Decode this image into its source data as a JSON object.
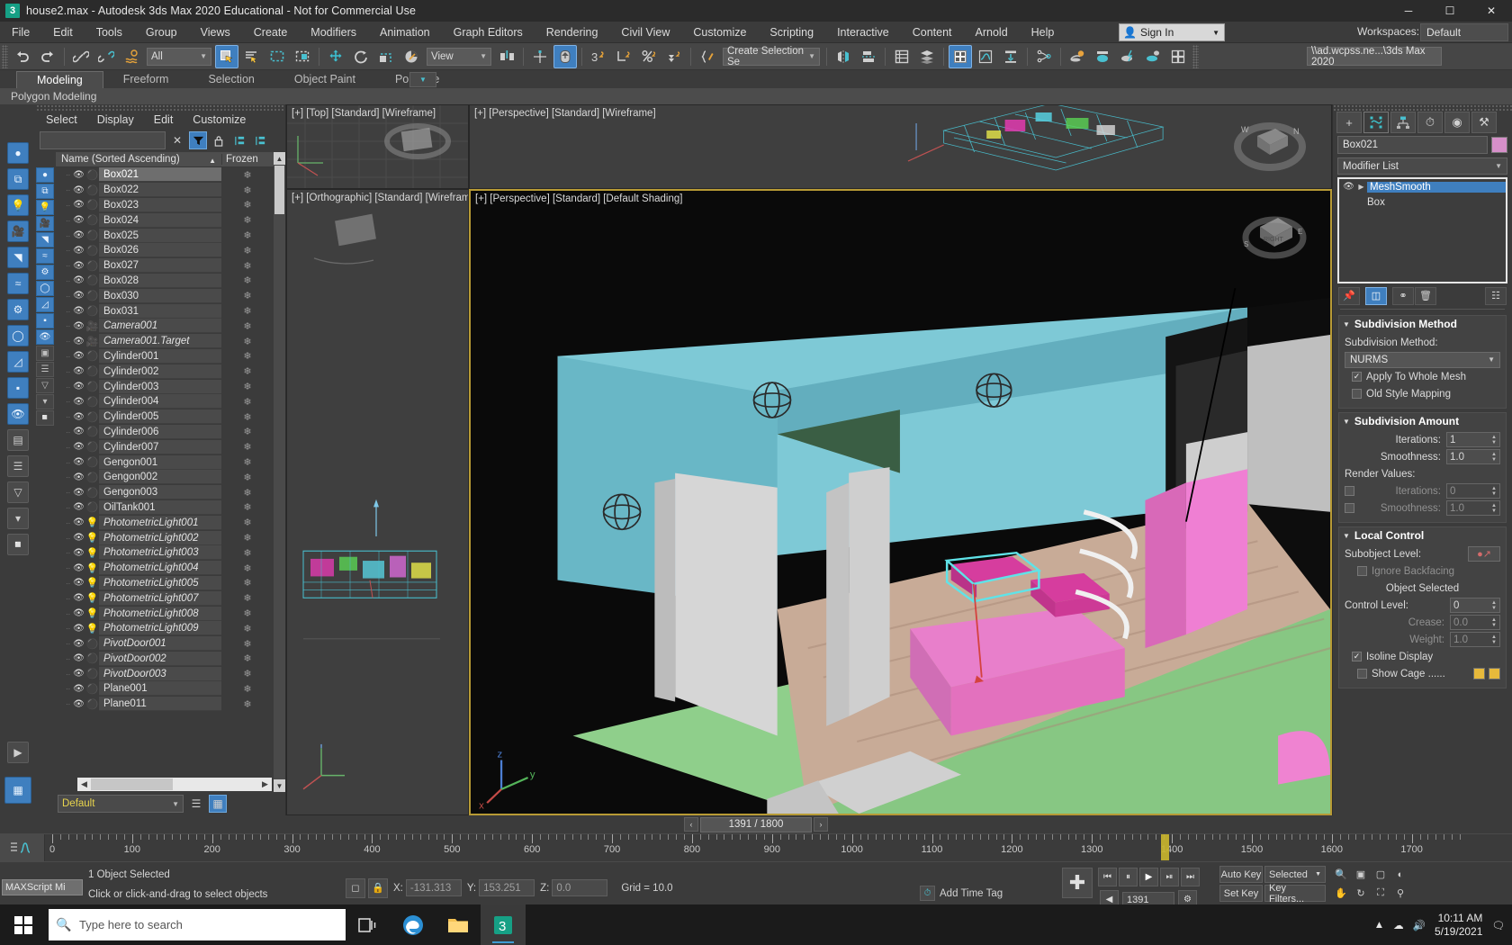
{
  "titlebar": {
    "text": "house2.max - Autodesk 3ds Max 2020 Educational - Not for Commercial Use",
    "app_icon": "3dsmax-icon",
    "minimize": "─",
    "maximize": "☐",
    "close": "✕"
  },
  "menubar": {
    "items": [
      "File",
      "Edit",
      "Tools",
      "Group",
      "Views",
      "Create",
      "Modifiers",
      "Animation",
      "Graph Editors",
      "Rendering",
      "Civil View",
      "Customize",
      "Scripting",
      "Interactive",
      "Content",
      "Arnold",
      "Help"
    ],
    "signin_label": "Sign In",
    "workspaces_label": "Workspaces:",
    "workspaces_value": "Default"
  },
  "toolbar": {
    "selection_filter": "All",
    "reference_coord": "View",
    "named_selection_set": "Create Selection Se",
    "project_path": "\\\\ad.wcpss.ne...\\3ds Max 2020",
    "buttons": [
      {
        "name": "undo",
        "glyph": "↶"
      },
      {
        "name": "redo",
        "glyph": "↷"
      },
      {
        "name": "select-and-link",
        "glyph": "⚭"
      },
      {
        "name": "unlink-selection",
        "glyph": "⚮"
      },
      {
        "name": "bind-to-space-warp",
        "glyph": "≈"
      },
      {
        "name": "select-object",
        "glyph": "◱"
      },
      {
        "name": "select-by-name",
        "glyph": "≣"
      },
      {
        "name": "rectangular-selection-region",
        "glyph": "⬚"
      },
      {
        "name": "window-crossing",
        "glyph": "▣"
      },
      {
        "name": "select-and-move",
        "glyph": "✥"
      },
      {
        "name": "select-and-rotate",
        "glyph": "↻"
      },
      {
        "name": "select-and-scale",
        "glyph": "◰"
      },
      {
        "name": "select-and-place",
        "glyph": "◔"
      },
      {
        "name": "use-center-flyout",
        "glyph": "⌖"
      },
      {
        "name": "select-and-manipulate",
        "glyph": "⬆"
      },
      {
        "name": "snaps-toggle",
        "glyph": "3"
      },
      {
        "name": "angle-snap-toggle",
        "glyph": "∠"
      },
      {
        "name": "percent-snap-toggle",
        "glyph": "%"
      },
      {
        "name": "spinner-snap-toggle",
        "glyph": "⇅"
      },
      {
        "name": "edit-named-selection-sets",
        "glyph": "{ }"
      },
      {
        "name": "mirror",
        "glyph": "◧"
      },
      {
        "name": "align",
        "glyph": "☷"
      },
      {
        "name": "layer-explorer",
        "glyph": "☰"
      },
      {
        "name": "scene-explorer",
        "glyph": "☲"
      },
      {
        "name": "curve-editor",
        "glyph": "∿"
      },
      {
        "name": "schematic-view",
        "glyph": "⤓"
      },
      {
        "name": "material-editor",
        "glyph": "⧉"
      },
      {
        "name": "render-setup",
        "glyph": "⚙"
      },
      {
        "name": "rendered-frame-window",
        "glyph": "▦"
      },
      {
        "name": "render-production",
        "glyph": "⚡"
      },
      {
        "name": "render-iterative",
        "glyph": "◑"
      },
      {
        "name": "open-asset-tracking",
        "glyph": "⊞"
      }
    ]
  },
  "ribbon": {
    "tabs": [
      "Modeling",
      "Freeform",
      "Selection",
      "Object Paint",
      "Populate"
    ],
    "active_tab": "Modeling",
    "panel_label": "Polygon Modeling"
  },
  "scene_explorer": {
    "menu": [
      "Select",
      "Display",
      "Edit",
      "Customize"
    ],
    "search_value": "",
    "clear_icon": "✕",
    "filter_icon": "filter-icon",
    "lock_icon": "lock-icon",
    "expand_icon": "expand-all-icon",
    "collapse_icon": "collapse-all-icon",
    "columns": {
      "name": "Name (Sorted Ascending)",
      "sort_arrow": "▲",
      "frozen": "Frozen"
    },
    "filter_buttons": [
      "geometry-filter",
      "shapes-filter",
      "lights-filter",
      "cameras-filter",
      "helpers-filter",
      "space-warps-filter",
      "groups-filter",
      "xrefs-filter",
      "bones-filter",
      "hidden-filter",
      "frozen-filter",
      "layers-filter",
      "containers-filter",
      "sort-filter",
      "advanced-filter",
      "misc-filter"
    ],
    "layer_selector": "Default",
    "rows": [
      {
        "name": "Box021",
        "type": "geometry",
        "selected": true,
        "italic": false,
        "frozen": "❄"
      },
      {
        "name": "Box022",
        "type": "geometry",
        "selected": false,
        "italic": false,
        "frozen": "❄"
      },
      {
        "name": "Box023",
        "type": "geometry",
        "selected": false,
        "italic": false,
        "frozen": "❄"
      },
      {
        "name": "Box024",
        "type": "geometry",
        "selected": false,
        "italic": false,
        "frozen": "❄"
      },
      {
        "name": "Box025",
        "type": "geometry",
        "selected": false,
        "italic": false,
        "frozen": "❄"
      },
      {
        "name": "Box026",
        "type": "geometry",
        "selected": false,
        "italic": false,
        "frozen": "❄"
      },
      {
        "name": "Box027",
        "type": "geometry",
        "selected": false,
        "italic": false,
        "frozen": "❄"
      },
      {
        "name": "Box028",
        "type": "geometry",
        "selected": false,
        "italic": false,
        "frozen": "❄"
      },
      {
        "name": "Box030",
        "type": "geometry",
        "selected": false,
        "italic": false,
        "frozen": "❄"
      },
      {
        "name": "Box031",
        "type": "geometry",
        "selected": false,
        "italic": false,
        "frozen": "❄"
      },
      {
        "name": "Camera001",
        "type": "camera",
        "selected": false,
        "italic": true,
        "frozen": "❄"
      },
      {
        "name": "Camera001.Target",
        "type": "camera",
        "selected": false,
        "italic": true,
        "frozen": "❄"
      },
      {
        "name": "Cylinder001",
        "type": "geometry",
        "selected": false,
        "italic": false,
        "frozen": "❄"
      },
      {
        "name": "Cylinder002",
        "type": "geometry",
        "selected": false,
        "italic": false,
        "frozen": "❄"
      },
      {
        "name": "Cylinder003",
        "type": "geometry",
        "selected": false,
        "italic": false,
        "frozen": "❄"
      },
      {
        "name": "Cylinder004",
        "type": "geometry",
        "selected": false,
        "italic": false,
        "frozen": "❄"
      },
      {
        "name": "Cylinder005",
        "type": "geometry",
        "selected": false,
        "italic": false,
        "frozen": "❄"
      },
      {
        "name": "Cylinder006",
        "type": "geometry",
        "selected": false,
        "italic": false,
        "frozen": "❄"
      },
      {
        "name": "Cylinder007",
        "type": "geometry",
        "selected": false,
        "italic": false,
        "frozen": "❄"
      },
      {
        "name": "Gengon001",
        "type": "geometry",
        "selected": false,
        "italic": false,
        "frozen": "❄"
      },
      {
        "name": "Gengon002",
        "type": "geometry",
        "selected": false,
        "italic": false,
        "frozen": "❄"
      },
      {
        "name": "Gengon003",
        "type": "geometry",
        "selected": false,
        "italic": false,
        "frozen": "❄"
      },
      {
        "name": "OilTank001",
        "type": "geometry",
        "selected": false,
        "italic": false,
        "frozen": "❄"
      },
      {
        "name": "PhotometricLight001",
        "type": "light",
        "selected": false,
        "italic": true,
        "frozen": "❄"
      },
      {
        "name": "PhotometricLight002",
        "type": "light",
        "selected": false,
        "italic": true,
        "frozen": "❄"
      },
      {
        "name": "PhotometricLight003",
        "type": "light",
        "selected": false,
        "italic": true,
        "frozen": "❄"
      },
      {
        "name": "PhotometricLight004",
        "type": "light",
        "selected": false,
        "italic": true,
        "frozen": "❄"
      },
      {
        "name": "PhotometricLight005",
        "type": "light",
        "selected": false,
        "italic": true,
        "frozen": "❄"
      },
      {
        "name": "PhotometricLight007",
        "type": "light",
        "selected": false,
        "italic": true,
        "frozen": "❄"
      },
      {
        "name": "PhotometricLight008",
        "type": "light",
        "selected": false,
        "italic": true,
        "frozen": "❄"
      },
      {
        "name": "PhotometricLight009",
        "type": "light",
        "selected": false,
        "italic": true,
        "frozen": "❄"
      },
      {
        "name": "PivotDoor001",
        "type": "geometry",
        "selected": false,
        "italic": true,
        "frozen": "❄"
      },
      {
        "name": "PivotDoor002",
        "type": "geometry",
        "selected": false,
        "italic": true,
        "frozen": "❄"
      },
      {
        "name": "PivotDoor003",
        "type": "geometry",
        "selected": false,
        "italic": true,
        "frozen": "❄"
      },
      {
        "name": "Plane001",
        "type": "geometry",
        "selected": false,
        "italic": false,
        "frozen": "❄"
      },
      {
        "name": "Plane011",
        "type": "geometry",
        "selected": false,
        "italic": false,
        "frozen": "❄"
      }
    ]
  },
  "viewports": [
    {
      "label": "[+] [Top] [Standard] [Wireframe]",
      "active": false,
      "name": "viewport-top"
    },
    {
      "label": "[+] [Perspective] [Standard] [Wireframe]",
      "active": false,
      "name": "viewport-perspective-wire"
    },
    {
      "label": "[+] [Orthographic] [Standard] [Wirefram",
      "active": false,
      "name": "viewport-orthographic"
    },
    {
      "label": "[+] [Perspective] [Standard] [Default Shading]",
      "active": true,
      "name": "viewport-perspective-shaded"
    }
  ],
  "command_panel": {
    "tabs": [
      "create-tab",
      "modify-tab",
      "hierarchy-tab",
      "motion-tab",
      "display-tab",
      "utilities-tab"
    ],
    "active_tab": "modify-tab",
    "object_name": "Box021",
    "object_color": "#d68fc9",
    "modifier_list_label": "Modifier List",
    "stack": [
      {
        "label": "MeshSmooth",
        "selected": true,
        "child": false
      },
      {
        "label": "Box",
        "selected": false,
        "child": true
      }
    ],
    "stack_buttons": [
      "pin-stack",
      "show-end-result",
      "make-unique",
      "remove-modifier",
      "configure-modifier-sets"
    ],
    "rollouts": [
      {
        "title": "Subdivision Method",
        "fields": [
          {
            "label": "Subdivision Method:",
            "type": "label"
          },
          {
            "label": "NURMS",
            "type": "combo"
          },
          {
            "label": "Apply To Whole Mesh",
            "type": "check",
            "checked": true
          },
          {
            "label": "Old Style Mapping",
            "type": "check",
            "checked": false
          }
        ]
      },
      {
        "title": "Subdivision Amount",
        "fields": [
          {
            "label": "Iterations:",
            "type": "spin",
            "value": "1"
          },
          {
            "label": "Smoothness:",
            "type": "spin",
            "value": "1.0"
          },
          {
            "label": "Render Values:",
            "type": "label"
          },
          {
            "label": "Iterations:",
            "type": "spin-check",
            "value": "0",
            "checked": false
          },
          {
            "label": "Smoothness:",
            "type": "spin-check",
            "value": "1.0",
            "checked": false
          }
        ]
      },
      {
        "title": "Local Control",
        "fields": [
          {
            "label": "Subobject Level:",
            "type": "subobj"
          },
          {
            "label": "Ignore Backfacing",
            "type": "check",
            "checked": false
          },
          {
            "label": "Object Selected",
            "type": "label"
          },
          {
            "label": "Control Level:",
            "type": "spin",
            "value": "0"
          },
          {
            "label": "Crease:",
            "type": "spin",
            "value": "0.0"
          },
          {
            "label": "Weight:",
            "type": "spin",
            "value": "1.0"
          },
          {
            "label": "Isoline Display",
            "type": "check",
            "checked": true
          },
          {
            "label": "Show Cage ......",
            "type": "check-swatch",
            "checked": false
          }
        ]
      }
    ]
  },
  "timeline": {
    "frame_display": "1391 / 1800",
    "prev_icon": "‹",
    "next_icon": "›",
    "current_frame": 1391,
    "total_frames": 1800,
    "tick_labels": [
      0,
      100,
      200,
      300,
      400,
      500,
      600,
      700,
      800,
      900,
      1000,
      1100,
      1200,
      1300,
      1400,
      1500,
      1600,
      1700
    ]
  },
  "statusbar": {
    "maxscript_label": "MAXScript Mi",
    "selection_status": "1 Object Selected",
    "prompt": "Click or click-and-drag to select objects",
    "coords": {
      "x_label": "X:",
      "x_value": "-131.313",
      "y_label": "Y:",
      "y_value": "153.251",
      "z_label": "Z:",
      "z_value": "0.0"
    },
    "grid_text": "Grid = 10.0",
    "add_time_tag": "Add Time Tag",
    "frame_field": "1391",
    "auto_key": "Auto Key",
    "set_key": "Set Key",
    "key_filters": "Key Filters...",
    "selected_combo": "Selected",
    "play_buttons": [
      "go-to-start",
      "previous-frame",
      "play-animation",
      "next-frame",
      "go-to-end"
    ],
    "nav_buttons": [
      "zoom-icon",
      "zoom-all-icon",
      "zoom-extents-icon",
      "field-of-view-icon",
      "pan-icon",
      "orbit-icon",
      "maximize-viewport-icon"
    ]
  },
  "taskbar": {
    "search_placeholder": "Type here to search",
    "apps": [
      {
        "name": "task-view-icon",
        "glyph": "▧"
      },
      {
        "name": "edge-browser-icon",
        "glyph": "◉"
      },
      {
        "name": "file-explorer-icon",
        "glyph": "὜0"
      },
      {
        "name": "3dsmax-taskbar-icon",
        "glyph": "3"
      }
    ],
    "time": "10:11 AM",
    "date": "5/19/2021",
    "tray_icons": [
      "show-hidden-icons",
      "network-icon",
      "volume-icon",
      "notifications-icon"
    ]
  }
}
